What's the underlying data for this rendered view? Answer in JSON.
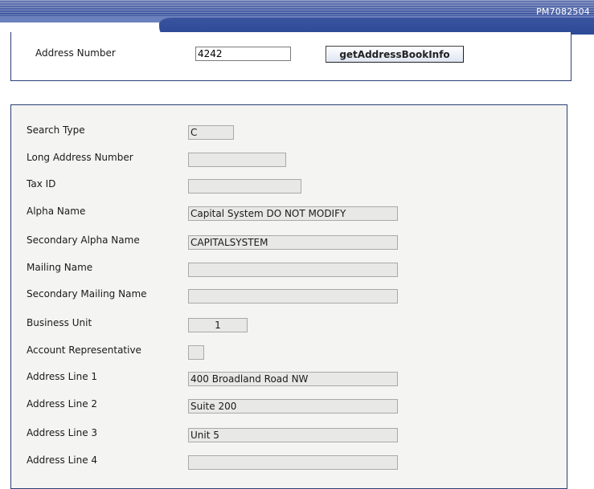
{
  "banner": {
    "code": "PM7082504"
  },
  "query": {
    "address_number_label": "Address Number",
    "address_number_value": "4242",
    "button_label": "getAddressBookInfo"
  },
  "record": {
    "search_type": {
      "label": "Search Type",
      "value": "C"
    },
    "long_address_number": {
      "label": "Long Address Number",
      "value": ""
    },
    "tax_id": {
      "label": "Tax ID",
      "value": ""
    },
    "alpha_name": {
      "label": "Alpha Name",
      "value": "Capital System DO NOT MODIFY"
    },
    "secondary_alpha_name": {
      "label": "Secondary Alpha Name",
      "value": "CAPITALSYSTEM"
    },
    "mailing_name": {
      "label": "Mailing Name",
      "value": ""
    },
    "secondary_mailing_name": {
      "label": "Secondary Mailing Name",
      "value": ""
    },
    "business_unit": {
      "label": "Business Unit",
      "value": "1"
    },
    "account_representative": {
      "label": "Account Representative",
      "value": ""
    },
    "address_line_1": {
      "label": "Address Line 1",
      "value": "400 Broadland Road NW"
    },
    "address_line_2": {
      "label": "Address Line 2",
      "value": "Suite 200"
    },
    "address_line_3": {
      "label": "Address Line 3",
      "value": "Unit 5"
    },
    "address_line_4": {
      "label": "Address Line 4",
      "value": ""
    }
  }
}
